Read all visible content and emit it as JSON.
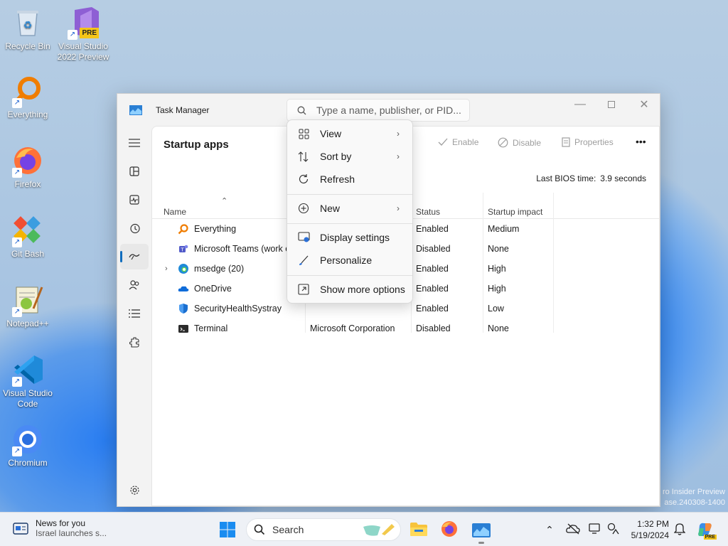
{
  "desktop": {
    "icons": [
      {
        "label": "Recycle Bin",
        "name": "recycle-bin"
      },
      {
        "label": "Visual Studio 2022 Preview",
        "name": "visual-studio"
      },
      {
        "label": "Everything",
        "name": "everything"
      },
      {
        "label": "Firefox",
        "name": "firefox"
      },
      {
        "label": "Git Bash",
        "name": "git-bash"
      },
      {
        "label": "Notepad++",
        "name": "notepad-plus-plus"
      },
      {
        "label": "Visual Studio Code",
        "name": "vscode"
      },
      {
        "label": "Chromium",
        "name": "chromium"
      }
    ],
    "vs_badge": "PRE",
    "watermark_line1": "ro Insider Preview",
    "watermark_line2": "ase.240308-1400"
  },
  "window": {
    "title": "Task Manager",
    "search_placeholder": "Type a name, publisher, or PID...",
    "page_title": "Startup apps",
    "commands": {
      "enable": "Enable",
      "disable": "Disable",
      "properties": "Properties",
      "more": "•••"
    },
    "bios_label": "Last BIOS time:",
    "bios_value": "3.9 seconds",
    "columns": {
      "name": "Name",
      "publisher": "",
      "status": "Status",
      "impact": "Startup impact"
    },
    "rows": [
      {
        "name": "Everything",
        "publisher": "",
        "status": "Enabled",
        "impact": "Medium"
      },
      {
        "name": "Microsoft Teams (work or school)",
        "publisher": "",
        "status": "Disabled",
        "impact": "None"
      },
      {
        "name": "msedge (20)",
        "publisher": "",
        "status": "Enabled",
        "impact": "High"
      },
      {
        "name": "OneDrive",
        "publisher": "",
        "status": "Enabled",
        "impact": "High"
      },
      {
        "name": "SecurityHealthSystray",
        "publisher": "",
        "status": "Enabled",
        "impact": "Low"
      },
      {
        "name": "Terminal",
        "publisher": "Microsoft Corporation",
        "status": "Disabled",
        "impact": "None"
      }
    ]
  },
  "context_menu": {
    "items": [
      {
        "label": "View",
        "icon": "grid-icon",
        "submenu": true
      },
      {
        "label": "Sort by",
        "icon": "sort-icon",
        "submenu": true
      },
      {
        "label": "Refresh",
        "icon": "refresh-icon",
        "submenu": false
      },
      {
        "label": "New",
        "icon": "plus-circle-icon",
        "submenu": true
      },
      {
        "label": "Display settings",
        "icon": "display-icon",
        "submenu": false
      },
      {
        "label": "Personalize",
        "icon": "brush-icon",
        "submenu": false
      },
      {
        "label": "Show more options",
        "icon": "more-options-icon",
        "submenu": false
      }
    ]
  },
  "taskbar": {
    "news_title": "News for you",
    "news_subtitle": "Israel launches s...",
    "search_label": "Search",
    "time": "1:32 PM",
    "date": "5/19/2024",
    "copilot_badge": "PRE"
  },
  "colors": {
    "accent": "#0f6cbd",
    "menu_bg": "#f9f9f9",
    "taskbar_bg": "#eef1f6"
  }
}
